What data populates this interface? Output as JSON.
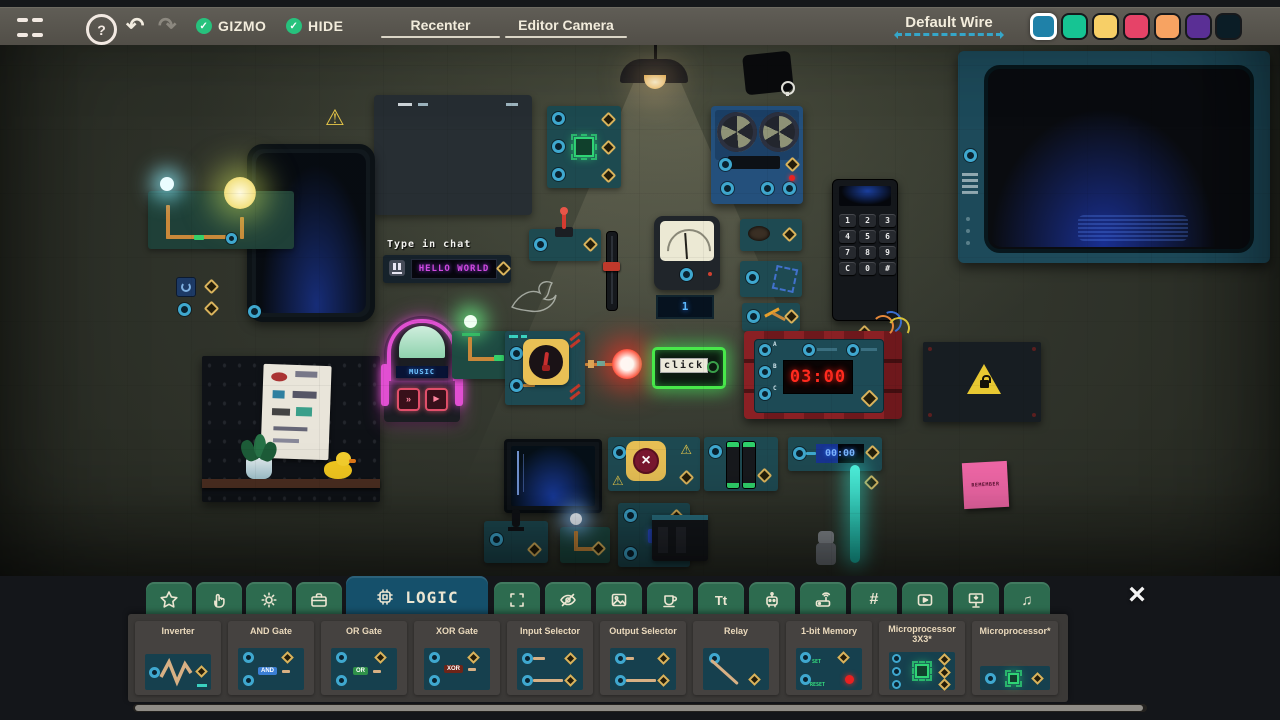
{
  "topbar": {
    "help_glyph": "?",
    "undo_glyph": "↶",
    "redo_glyph": "↷",
    "check_glyph": "✓",
    "toggles": [
      {
        "label": "GIZMO"
      },
      {
        "label": "HIDE"
      }
    ],
    "buttons": {
      "recenter": "Recenter",
      "editor_camera": "Editor Camera"
    },
    "wire_selector": {
      "label": "Default Wire"
    },
    "palette": {
      "selected_index": 0,
      "colors": [
        "#1f81a8",
        "#16c493",
        "#f7cf67",
        "#e64368",
        "#f7a362",
        "#5a2f95",
        "#0b1d26"
      ]
    }
  },
  "canvas": {
    "chat": {
      "caption": "Type in chat",
      "display": "HELLO WORLD"
    },
    "jukebox": {
      "label": "MUSIC",
      "skip_glyph": "»",
      "play_glyph": "▶"
    },
    "click_button": {
      "label": "click"
    },
    "bomb": {
      "display": "03:00",
      "port_labels": [
        "A",
        "B",
        "C"
      ]
    },
    "keypad": {
      "keys": [
        "1",
        "2",
        "3",
        "4",
        "5",
        "6",
        "7",
        "8",
        "9",
        "C",
        "0",
        "#"
      ]
    },
    "counter": {
      "display": "00:00"
    },
    "meter_display": {
      "value": "1"
    },
    "sticky_note": {
      "text": "REMEMBER"
    },
    "warning_glyph": "⚠"
  },
  "tabs": {
    "active": {
      "label": "LOGIC"
    },
    "tool_glyphs": {
      "text": "Tt",
      "hash": "#",
      "music": "♫"
    }
  },
  "panel": {
    "items": [
      {
        "name": "Inverter"
      },
      {
        "name": "AND Gate",
        "chip": "AND",
        "chip_color": "#3b7fd4"
      },
      {
        "name": "OR Gate",
        "chip": "OR",
        "chip_color": "#2f9149"
      },
      {
        "name": "XOR Gate",
        "chip": "XOR",
        "chip_color": "#6e2418"
      },
      {
        "name": "Input Selector"
      },
      {
        "name": "Output Selector"
      },
      {
        "name": "Relay"
      },
      {
        "name": "1-bit Memory",
        "labels": [
          "SET",
          "RESET"
        ]
      },
      {
        "name": "Microprocessor 3X3*"
      },
      {
        "name": "Microprocessor*"
      }
    ]
  },
  "close_glyph": "×"
}
